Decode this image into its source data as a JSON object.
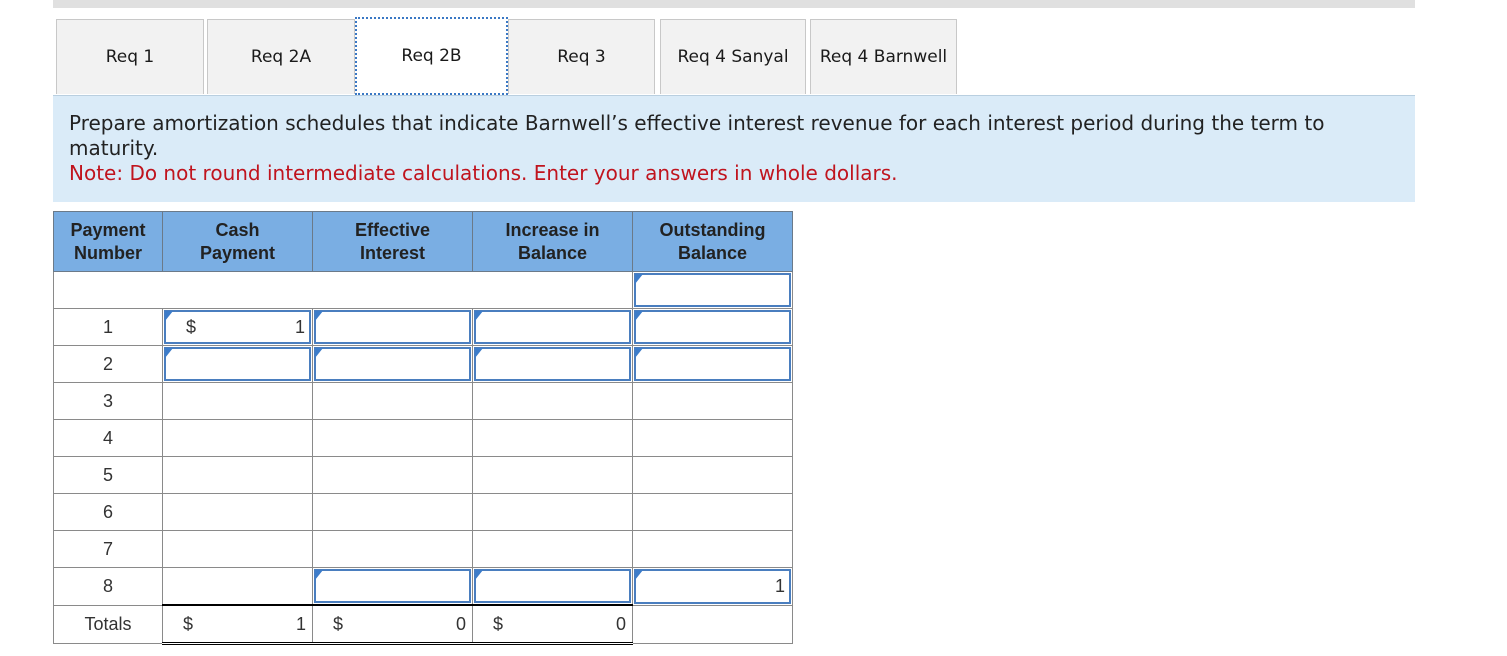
{
  "tabs": [
    {
      "label": "Req 1",
      "active": false
    },
    {
      "label": "Req 2A",
      "active": false
    },
    {
      "label": "Req 2B",
      "active": true
    },
    {
      "label": "Req 3",
      "active": false
    },
    {
      "label": "Req 4 Sanyal",
      "active": false
    },
    {
      "label": "Req 4 Barnwell",
      "active": false
    }
  ],
  "instructions": {
    "text": "Prepare amortization schedules that indicate Barnwell’s effective interest revenue for each interest period during the term to maturity.",
    "note": "Note: Do not round intermediate calculations. Enter your answers in whole dollars."
  },
  "table": {
    "headers": [
      "Payment\nNumber",
      "Cash\nPayment",
      "Effective\nInterest",
      "Increase in\nBalance",
      "Outstanding\nBalance"
    ],
    "header_lines": [
      [
        "Payment",
        "Number"
      ],
      [
        "Cash",
        "Payment"
      ],
      [
        "Effective",
        "Interest"
      ],
      [
        "Increase in",
        "Balance"
      ],
      [
        "Outstanding",
        "Balance"
      ]
    ],
    "initial_row": {
      "outstanding_balance": ""
    },
    "rows": [
      {
        "number": "1",
        "cash_currency": "$",
        "cash_payment": "1",
        "effective_interest": "",
        "increase_in_balance": "",
        "outstanding_balance": ""
      },
      {
        "number": "2",
        "cash_payment": "",
        "effective_interest": "",
        "increase_in_balance": "",
        "outstanding_balance": ""
      },
      {
        "number": "3"
      },
      {
        "number": "4"
      },
      {
        "number": "5"
      },
      {
        "number": "6"
      },
      {
        "number": "7"
      },
      {
        "number": "8",
        "effective_interest": "",
        "increase_in_balance": "",
        "outstanding_balance": "1"
      }
    ],
    "totals": {
      "label": "Totals",
      "cash_currency": "$",
      "cash_payment": "1",
      "interest_currency": "$",
      "effective_interest": "0",
      "increase_currency": "$",
      "increase_in_balance": "0"
    }
  },
  "colors": {
    "header_bg": "#7aaee3",
    "instruction_bg": "#daebf8",
    "note_text": "#c0141e",
    "input_border": "#4a7ebf",
    "active_tab_border": "#3a78c4"
  }
}
